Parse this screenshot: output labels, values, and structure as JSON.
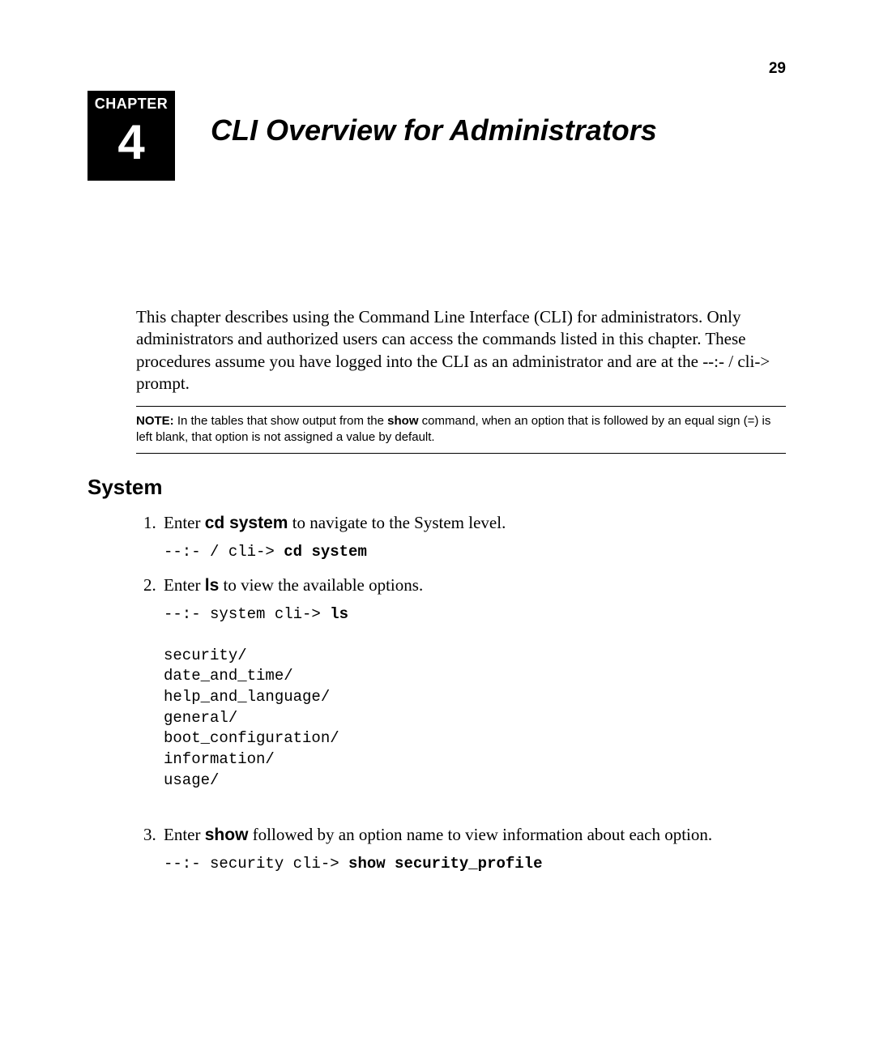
{
  "page_number": "29",
  "chapter": {
    "label": "CHAPTER",
    "number": "4"
  },
  "title": "CLI Overview for Administrators",
  "intro": "This chapter describes using the Command Line Interface (CLI) for administrators. Only administrators and authorized users can access the commands listed in this chapter. These procedures assume you have logged into the CLI as an administrator and are at the --:- / cli-> prompt.",
  "note": {
    "label": "NOTE:",
    "before": " In the tables that show output from the ",
    "bold_cmd": "show",
    "after": " command, when an option that is followed by an equal sign (=) is left blank, that option is not assigned a value by default."
  },
  "section_heading": "System",
  "steps": {
    "s1": {
      "pre": "Enter ",
      "cmd": "cd system",
      "post": " to navigate to the System level.",
      "code_prompt": "--:- / cli-> ",
      "code_cmd": "cd system"
    },
    "s2": {
      "pre": "Enter ",
      "cmd": "ls",
      "post": " to view the available options.",
      "code_prompt": "--:- system cli-> ",
      "code_cmd": "ls",
      "output": "security/\ndate_and_time/\nhelp_and_language/\ngeneral/\nboot_configuration/\ninformation/\nusage/"
    },
    "s3": {
      "pre": "Enter ",
      "cmd": "show",
      "post": " followed by an option name to view information about each option.",
      "code_prompt": "--:- security cli-> ",
      "code_cmd": "show security_profile"
    }
  }
}
